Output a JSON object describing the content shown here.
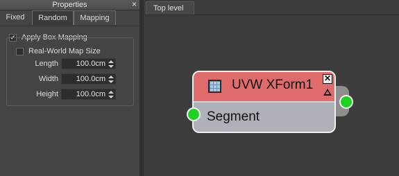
{
  "panel": {
    "title": "Properties",
    "close_glyph": "×",
    "tabs": [
      {
        "label": "Fixed",
        "active": false
      },
      {
        "label": "Random",
        "active": false
      },
      {
        "label": "Mapping",
        "active": true
      }
    ]
  },
  "mapping": {
    "apply_box_mapping": {
      "label": "Apply Box Mapping",
      "checked": true
    },
    "real_world_map_size": {
      "label": "Real-World Map Size",
      "checked": false
    },
    "fields": [
      {
        "label": "Length",
        "value": "100.0cm"
      },
      {
        "label": "Width",
        "value": "100.0cm"
      },
      {
        "label": "Height",
        "value": "100.0cm"
      }
    ]
  },
  "canvas": {
    "tab_label": "Top level",
    "node": {
      "title": "UVW XForm1",
      "icon": "uvw-xform-icon",
      "close_glyph": "✕",
      "input_label": "Segment",
      "colors": {
        "header": "#e06b6b",
        "body": "#b0b0b8",
        "socket": "#1fd21f"
      }
    }
  },
  "check_glyph": "✔"
}
